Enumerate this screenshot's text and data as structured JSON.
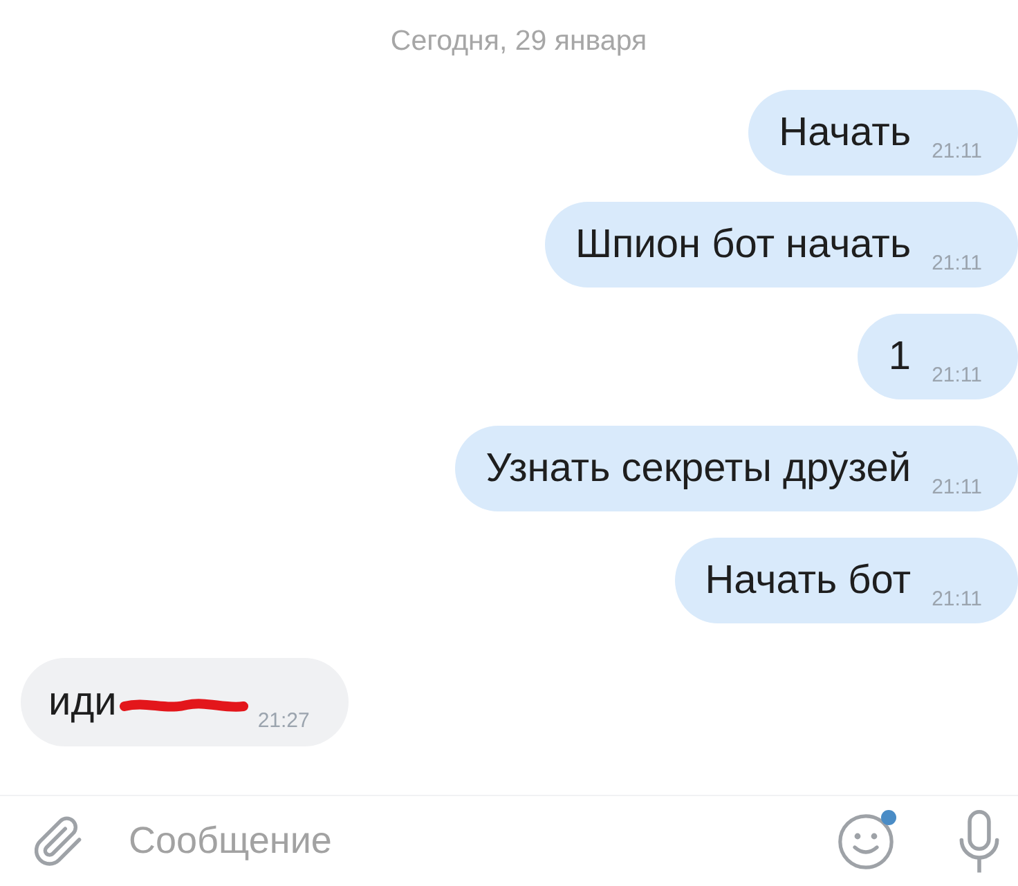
{
  "date_separator": "Сегодня, 29 января",
  "messages": [
    {
      "kind": "outgoing",
      "text": "Начать",
      "time": "21:11"
    },
    {
      "kind": "outgoing",
      "text": "Шпион бот начать",
      "time": "21:11"
    },
    {
      "kind": "outgoing",
      "text": "1",
      "time": "21:11"
    },
    {
      "kind": "outgoing",
      "text": "Узнать секреты друзей",
      "time": "21:11"
    },
    {
      "kind": "outgoing",
      "text": "Начать бот",
      "time": "21:11"
    },
    {
      "kind": "incoming",
      "text": "иди",
      "redacted": true,
      "time": "21:27"
    }
  ],
  "composer": {
    "placeholder": "Сообщение",
    "emoji_badge": true
  }
}
